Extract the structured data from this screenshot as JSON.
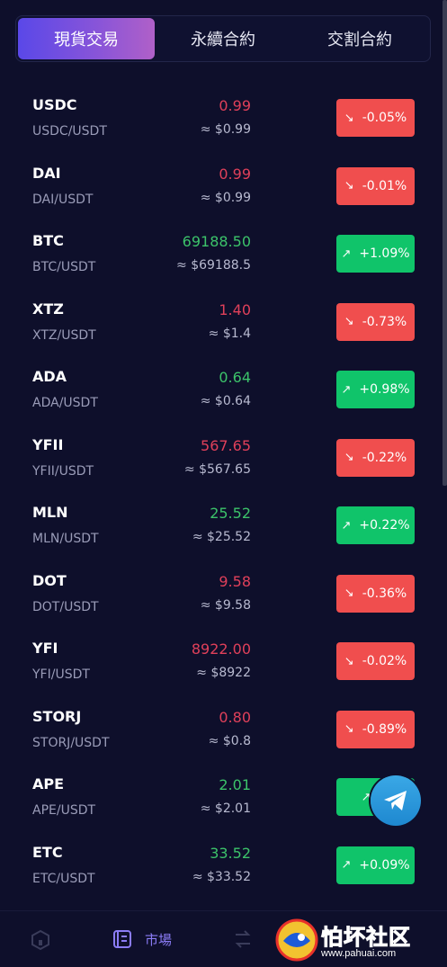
{
  "tabs": [
    {
      "label": "現貨交易",
      "active": true
    },
    {
      "label": "永續合約",
      "active": false
    },
    {
      "label": "交割合約",
      "active": false
    }
  ],
  "markets": [
    {
      "symbol": "USDC",
      "pair": "USDC/USDT",
      "price": "0.99",
      "approx": "≈ $0.99",
      "change": "-0.05%",
      "direction": "down"
    },
    {
      "symbol": "DAI",
      "pair": "DAI/USDT",
      "price": "0.99",
      "approx": "≈ $0.99",
      "change": "-0.01%",
      "direction": "down"
    },
    {
      "symbol": "BTC",
      "pair": "BTC/USDT",
      "price": "69188.50",
      "approx": "≈ $69188.5",
      "change": "+1.09%",
      "direction": "up"
    },
    {
      "symbol": "XTZ",
      "pair": "XTZ/USDT",
      "price": "1.40",
      "approx": "≈ $1.4",
      "change": "-0.73%",
      "direction": "down"
    },
    {
      "symbol": "ADA",
      "pair": "ADA/USDT",
      "price": "0.64",
      "approx": "≈ $0.64",
      "change": "+0.98%",
      "direction": "up"
    },
    {
      "symbol": "YFII",
      "pair": "YFII/USDT",
      "price": "567.65",
      "approx": "≈ $567.65",
      "change": "-0.22%",
      "direction": "down"
    },
    {
      "symbol": "MLN",
      "pair": "MLN/USDT",
      "price": "25.52",
      "approx": "≈ $25.52",
      "change": "+0.22%",
      "direction": "up"
    },
    {
      "symbol": "DOT",
      "pair": "DOT/USDT",
      "price": "9.58",
      "approx": "≈ $9.58",
      "change": "-0.36%",
      "direction": "down"
    },
    {
      "symbol": "YFI",
      "pair": "YFI/USDT",
      "price": "8922.00",
      "approx": "≈ $8922",
      "change": "-0.02%",
      "direction": "down"
    },
    {
      "symbol": "STORJ",
      "pair": "STORJ/USDT",
      "price": "0.80",
      "approx": "≈ $0.8",
      "change": "-0.89%",
      "direction": "down"
    },
    {
      "symbol": "APE",
      "pair": "APE/USDT",
      "price": "2.01",
      "approx": "≈ $2.01",
      "change": "+",
      "direction": "up"
    },
    {
      "symbol": "ETC",
      "pair": "ETC/USDT",
      "price": "33.52",
      "approx": "≈ $33.52",
      "change": "+0.09%",
      "direction": "up"
    }
  ],
  "bottom_nav": {
    "market_label": "市場"
  },
  "watermark": {
    "text": "怕坏社区",
    "url": "www.pahuai.com"
  },
  "colors": {
    "background": "#0e0f2b",
    "up": "#10c46a",
    "down": "#f04e4e",
    "accent": "#8b7cf6"
  },
  "icons": {
    "down_arrow": "trend-down-icon",
    "up_arrow": "trend-up-icon",
    "telegram": "telegram-icon"
  }
}
